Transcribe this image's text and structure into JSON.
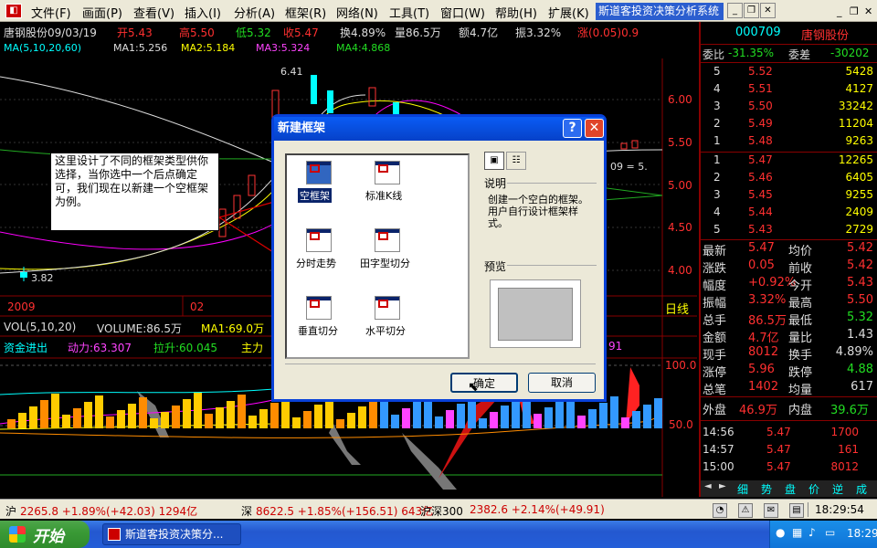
{
  "menubar": {
    "items": [
      "文件(F)",
      "画面(P)",
      "查看(V)",
      "插入(I)",
      "分析(A)",
      "框架(R)",
      "网络(N)",
      "工具(T)",
      "窗口(W)",
      "帮助(H)",
      "扩展(K)"
    ],
    "title": "斯道客投资决策分析系统",
    "btn_min": "_",
    "btn_restore": "❐",
    "btn_close": "✕"
  },
  "chart": {
    "stock": "唐钢股份09/03/19",
    "open": "开5.43",
    "high": "高5.50",
    "low": "低5.32",
    "close": "收5.47",
    "turnover": "换4.89%",
    "volume": "量86.5万",
    "amount": "额4.7亿",
    "amplitude": "振3.32%",
    "change": "涨(0.05)0.9",
    "ma_title": "MA(5,10,20,60)",
    "ma1": "MA1:5.256",
    "ma2": "MA2:5.184",
    "ma3": "MA3:5.324",
    "ma4": "MA4:4.868",
    "y_ticks": [
      "6.00",
      "5.50",
      "5.00",
      "4.50",
      "4.00"
    ],
    "high_label": "6.41",
    "low_label": "3.82",
    "right_label": "09 = 5.",
    "x_labels": [
      "2009",
      "02"
    ],
    "period": "日线",
    "vol_title": "VOL(5,10,20)",
    "vol_value": "VOLUME:86.5万",
    "vol_ma1": "MA1:69.0万",
    "fund_title": "资金进出",
    "fund_power": "动力:63.307",
    "fund_pull": "拉升:60.045",
    "fund_main": "主力",
    "fund_tail": "91",
    "fund_ticks": [
      "100.0",
      "50.0"
    ]
  },
  "quote": {
    "code": "000709",
    "name": "唐钢股份",
    "ratio_label": "委比",
    "ratio": "-31.35%",
    "diff_label": "委差",
    "diff": "-30202",
    "sell": [
      [
        "5",
        "5.52",
        "5428"
      ],
      [
        "4",
        "5.51",
        "4127"
      ],
      [
        "3",
        "5.50",
        "33242"
      ],
      [
        "2",
        "5.49",
        "11204"
      ],
      [
        "1",
        "5.48",
        "9263"
      ]
    ],
    "buy": [
      [
        "1",
        "5.47",
        "12265"
      ],
      [
        "2",
        "5.46",
        "6405"
      ],
      [
        "3",
        "5.45",
        "9255"
      ],
      [
        "4",
        "5.44",
        "2409"
      ],
      [
        "5",
        "5.43",
        "2729"
      ]
    ],
    "stats": [
      [
        "最新",
        "5.47",
        "均价",
        "5.42"
      ],
      [
        "涨跌",
        "0.05",
        "前收",
        "5.42"
      ],
      [
        "幅度",
        "+0.92%",
        "今开",
        "5.43"
      ],
      [
        "振幅",
        "3.32%",
        "最高",
        "5.50"
      ],
      [
        "总手",
        "86.5万",
        "最低",
        "5.32"
      ],
      [
        "金额",
        "4.7亿",
        "量比",
        "1.43"
      ],
      [
        "现手",
        "8012",
        "换手",
        "4.89%"
      ],
      [
        "涨停",
        "5.96",
        "跌停",
        "4.88"
      ],
      [
        "总笔",
        "1402",
        "均量",
        "617"
      ]
    ],
    "outer_label": "外盘",
    "outer": "46.9万",
    "inner_label": "内盘",
    "inner": "39.6万",
    "ticks": [
      [
        "14:56",
        "5.47",
        "1700"
      ],
      [
        "14:57",
        "5.47",
        "161"
      ],
      [
        "15:00",
        "5.47",
        "8012"
      ]
    ],
    "tabs": [
      "细",
      "势",
      "盘",
      "价",
      "逆",
      "成"
    ]
  },
  "dialog": {
    "title": "新建框架",
    "help": "?",
    "close": "✕",
    "items": [
      "空框架",
      "标准K线",
      "分时走势",
      "田字型切分",
      "垂直切分",
      "水平切分"
    ],
    "desc_title": "说明",
    "desc": "创建一个空白的框架。用户自行设计框架样式。",
    "preview_title": "预览",
    "ok": "确定",
    "cancel": "取消"
  },
  "annotation": "这里设计了不同的框架类型供你选择，当你选中一个后点确定可，我们现在以新建一个空框架为例。",
  "status": {
    "sh_label": "沪",
    "sh": "2265.8 +1.89%(+42.03) 1294亿",
    "sz_label": "深",
    "sz": "8622.5 +1.85%(+156.51) 643亿",
    "hs_label": "沪深300",
    "hs": "2382.6 +2.14%(+49.91)",
    "time": "18:29:54"
  },
  "taskbar": {
    "start": "开始",
    "task": "斯道客投资决策分...",
    "clock": "18:29"
  }
}
